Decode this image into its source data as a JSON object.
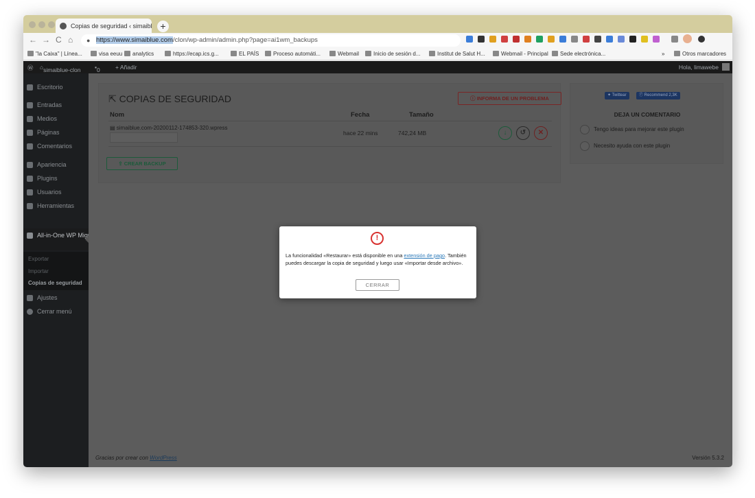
{
  "browser": {
    "tab_title": "Copias de seguridad ‹ simaiblu",
    "tab_close": "×",
    "newtab": "+",
    "nav": {
      "back": "←",
      "forward": "→",
      "reload": "C",
      "home": "⌂"
    },
    "url_host": "https://www.simaiblue.com",
    "url_path": "/clon/wp-admin/admin.php?page=ai1wm_backups",
    "star": "☆",
    "bookmarks": [
      "\"la Caixa\" | Línea...",
      "visa eeuu",
      "analytics",
      "https://ecap.ics.g...",
      "EL PAÍS",
      "Proceso automáti...",
      "Webmail",
      "Inicio de sesión d...",
      "Institut de Salut H...",
      "Webmail - Principal",
      "Sede electrónica..."
    ],
    "bookmarks_more": "»",
    "bookmarks_other": "Otros marcadores"
  },
  "adminbar": {
    "site": "simaiblue-clon",
    "comments": "0",
    "add": "+ Añadir",
    "greeting": "Hola, limawebe"
  },
  "sidebar": {
    "items": [
      "Escritorio",
      "Entradas",
      "Medios",
      "Páginas",
      "Comentarios",
      "Apariencia",
      "Plugins",
      "Usuarios",
      "Herramientas"
    ],
    "active": "All-in-One WP Migration",
    "submenu": [
      "Exportar",
      "Importar",
      "Copias de seguridad"
    ],
    "after": [
      "Ajustes",
      "Cerrar menú"
    ]
  },
  "main": {
    "title": "COPIAS DE SEGURIDAD",
    "report_button": "ⓘ INFORMA DE UN PROBLEMA",
    "columns": [
      "Nom",
      "Fecha",
      "Tamaño"
    ],
    "backup": {
      "file": "simaiblue.com-20200112-174853-320.wpress",
      "date": "hace 22 mins",
      "size": "742,24 MB"
    },
    "create_button": "⇪ CREAR BACKUP"
  },
  "aside": {
    "twitter": "Twittear",
    "facebook": "Recommend 2,3K",
    "heading": "DEJA UN COMENTARIO",
    "options": [
      "Tengo ideas para mejorar este plugin",
      "Necesito ayuda con este plugin"
    ]
  },
  "footer": {
    "thanks": "Gracias por crear con ",
    "link": "WordPress",
    "version": "Versión 5.3.2"
  },
  "modal": {
    "icon": "!",
    "text_before": "La funcionalidad «Restaurar» está disponible en una ",
    "link": "extensión de pago",
    "text_after": ". También puedes descargar la copia de seguridad y luego usar «Importar desde archivo».",
    "close_button": "CERRAR"
  },
  "colors": {
    "accent": "#d8312f",
    "link": "#2a78b8",
    "adminbar": "#1a1a1a",
    "overlay": "#5c5c5c"
  }
}
